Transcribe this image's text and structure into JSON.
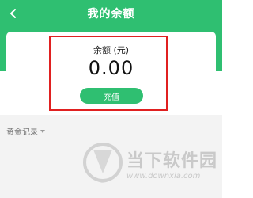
{
  "header": {
    "title": "我的余额",
    "back_icon": "chevron-left-icon",
    "background_color": "#2fbf71"
  },
  "balance": {
    "label": "余额 (元)",
    "amount": "0.00",
    "recharge_label": "充值",
    "highlight_color": "#e02020"
  },
  "records": {
    "label": "资金记录",
    "caret_icon": "caret-down-icon"
  },
  "watermark": {
    "name": "当下软件园",
    "url": "www.downxia.com"
  }
}
